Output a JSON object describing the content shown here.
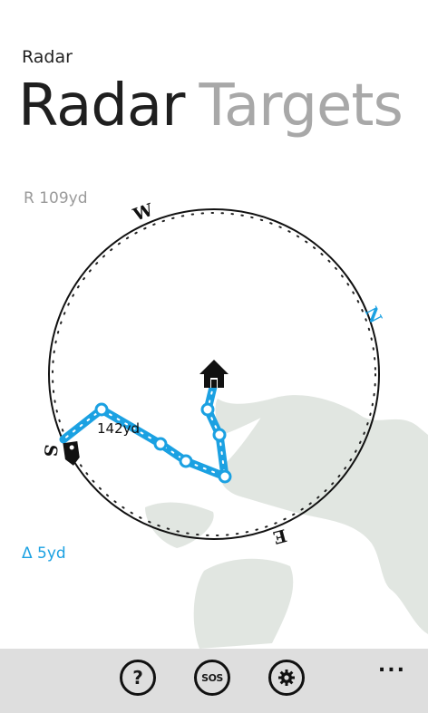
{
  "app": {
    "title": "Radar"
  },
  "pivot": {
    "tabs": [
      "Radar",
      "Targets"
    ],
    "active": 0
  },
  "radar": {
    "range_label": "R 109yd",
    "delta_label": "Δ 5yd",
    "distance_label": "142yd",
    "compass": {
      "north": "N",
      "south": "S",
      "east": "E",
      "west": "W"
    }
  },
  "colors": {
    "accent": "#1ba1e2",
    "map": "#e1e6e1",
    "appbar": "#dedede"
  },
  "appbar": {
    "buttons": [
      {
        "icon": "help-icon"
      },
      {
        "icon": "sos-icon",
        "label": "SOS"
      },
      {
        "icon": "settings-icon"
      }
    ],
    "more_label": "..."
  }
}
